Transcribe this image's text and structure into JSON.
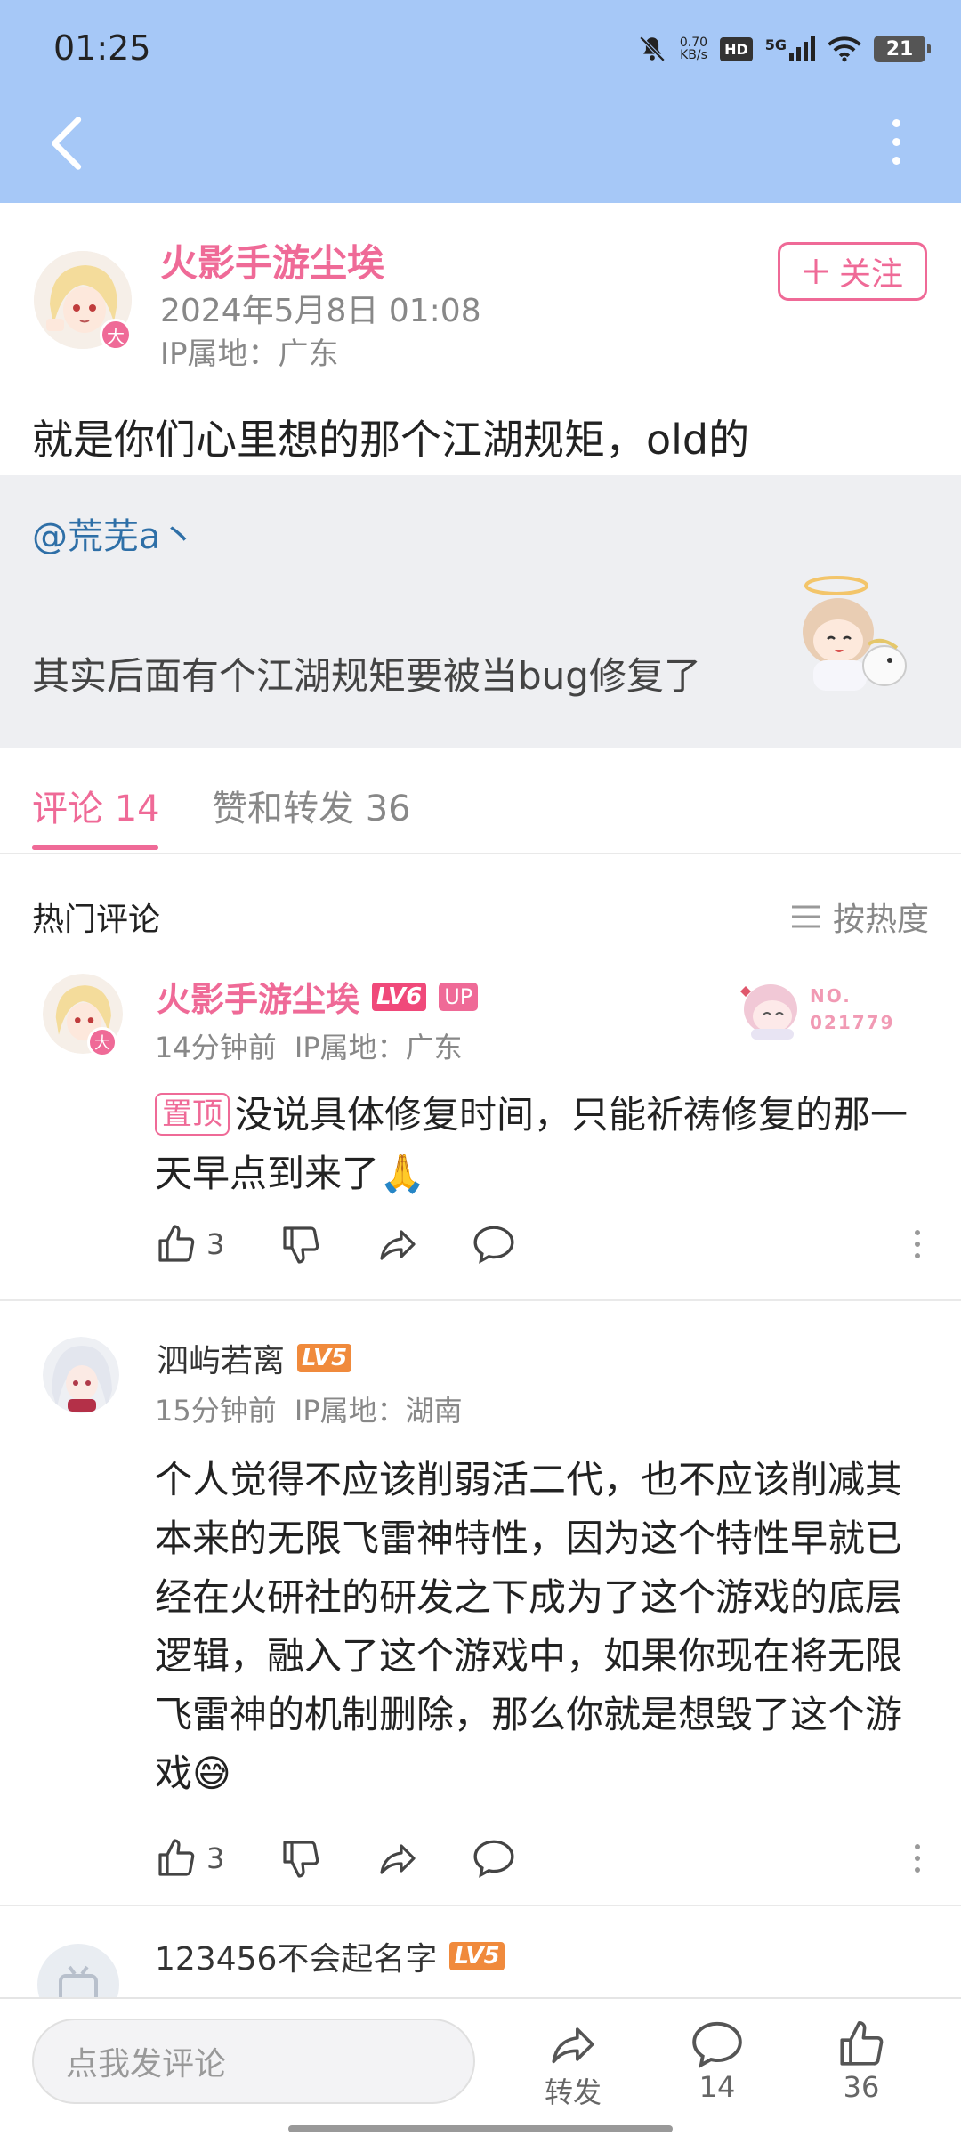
{
  "status_bar": {
    "time": "01:25",
    "net_speed_value": "0.70",
    "net_speed_unit": "KB/s",
    "hd": "HD",
    "signal": "5G",
    "battery": "21"
  },
  "post": {
    "author": "火影手游尘埃",
    "avatar_badge": "大",
    "date": "2024年5月8日 01:08",
    "ip": "IP属地：广东",
    "follow_label": "关注",
    "content": "就是你们心里想的那个江湖规矩，old的",
    "quoted": {
      "mention": "@荒芜a丶",
      "text": "其实后面有个江湖规矩要被当bug修复了"
    }
  },
  "tabs": {
    "comments": "评论 14",
    "likes_reposts": "赞和转发 36"
  },
  "hot": {
    "title": "热门评论",
    "sort_label": "按热度"
  },
  "comments": [
    {
      "name": "火影手游尘埃",
      "level": "LV6",
      "level_color": "#f0497a",
      "up": "UP",
      "avatar_badge": "大",
      "time": "14分钟前",
      "ip": "IP属地：广东",
      "decoration_no_label": "NO.",
      "decoration_no_value": "021779",
      "pin": "置顶",
      "text": "没说具体修复时间，只能祈祷修复的那一天早点到来了🙏",
      "likes": "3"
    },
    {
      "name": "泗屿若离",
      "level": "LV5",
      "level_color": "#f08a3c",
      "time": "15分钟前",
      "ip": "IP属地：湖南",
      "text": "个人觉得不应该削弱活二代，也不应该削减其本来的无限飞雷神特性，因为这个特性早就已经在火研社的研发之下成为了这个游戏的底层逻辑，融入了这个游戏中，如果你现在将无限飞雷神的机制删除，那么你就是想毁了这个游戏😅",
      "likes": "3"
    },
    {
      "name": "123456不会起名字",
      "level": "LV5",
      "level_color": "#f08a3c"
    }
  ],
  "bottom_bar": {
    "input_placeholder": "点我发评论",
    "repost_label": "转发",
    "comment_count": "14",
    "like_count": "36"
  },
  "colors": {
    "header_bg": "#a6c8f7",
    "accent": "#ef6a97",
    "link": "#2e6fa7"
  }
}
